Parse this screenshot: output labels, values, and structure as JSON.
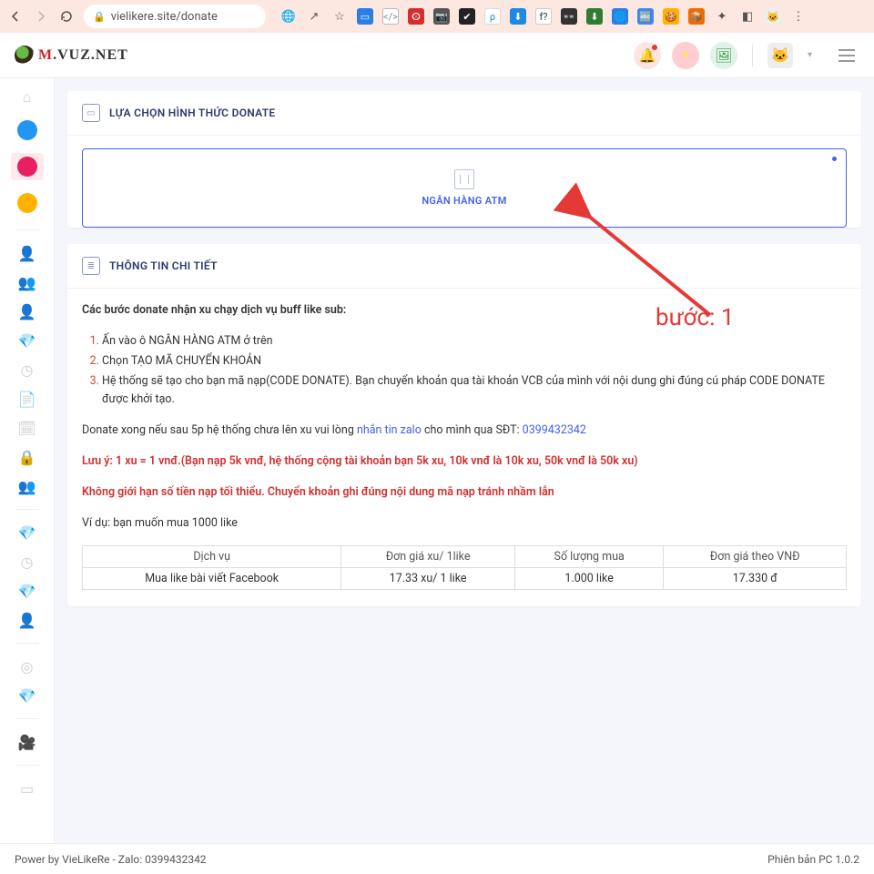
{
  "browser": {
    "url": "vielikere.site/donate",
    "extensions": [
      "translate",
      "share",
      "star",
      "panel",
      "dev",
      "so",
      "cam",
      "note",
      "p",
      "down",
      "f",
      "mask",
      "dl2",
      "globe",
      "hand",
      "cookie",
      "pkg",
      "puzzle",
      "side",
      "cat"
    ]
  },
  "appbar": {
    "brand_m": "M",
    "brand_rest": ".VUZ.NET"
  },
  "card1": {
    "title": "LỰA CHỌN HÌNH THỨC DONATE",
    "atm_label": "NGÂN HÀNG ATM"
  },
  "card2": {
    "title": "THÔNG TIN CHI TIẾT"
  },
  "content": {
    "intro": "Các bước donate nhận xu chạy dịch vụ buff like sub:",
    "step1_a": "Ấn vào ô ",
    "step1_link": "NGÂN HÀNG ATM",
    "step1_b": " ở trên",
    "step2_a": "Chọn ",
    "step2_link": "TẠO MÃ CHUYỂN KHOẢN",
    "step3": "Hệ thống sẽ tạo cho bạn mã nạp(CODE DONATE). Bạn chuyển khoản qua tài khoản VCB của mình với nội dung ghi đúng cú pháp CODE DONATE được khởi tạo.",
    "after_a": "Donate xong nếu sau 5p hệ thống chưa lên xu vui lòng ",
    "after_link": "nhắn tin zalo",
    "after_b": " cho mình qua SĐT: ",
    "after_phone": "0399432342",
    "note1": "Lưu ý: 1 xu = 1 vnđ.(Bạn nạp 5k vnđ, hệ thống cộng tài khoản bạn 5k xu, 10k vnđ là 10k xu, 50k vnđ là 50k xu)",
    "note2": "Không giới hạn số tiền nạp tối thiểu. Chuyển khoản ghi đúng nội dung mã nạp tránh nhầm lẫn",
    "example": "Ví dụ: bạn muốn mua 1000 like"
  },
  "table": {
    "h1": "Dịch vụ",
    "h2": "Đơn giá xu/ 1like",
    "h3": "Số lượng mua",
    "h4": "Đơn giá theo VNĐ",
    "r1c1": "Mua like bài viết Facebook",
    "r1c2": "17.33 xu/ 1 like",
    "r1c3": "1.000 like",
    "r1c4": "17.330 đ"
  },
  "annotation": {
    "label": "bước: 1"
  },
  "footer": {
    "left": "Power by VieLikeRe - Zalo: 0399432342",
    "right": "Phiên bản PC 1.0.2"
  }
}
